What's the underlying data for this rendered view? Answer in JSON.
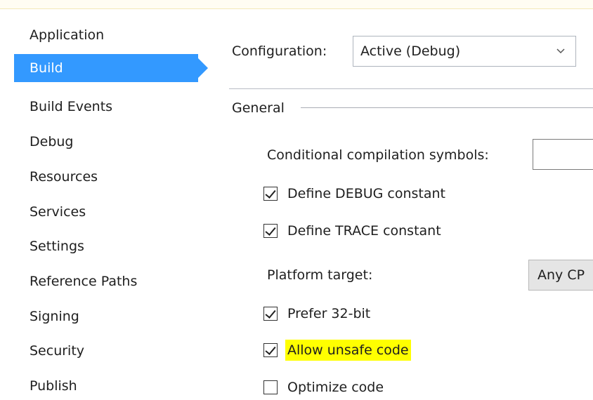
{
  "sidebar": {
    "items": [
      {
        "label": "Application"
      },
      {
        "label": "Build"
      },
      {
        "label": "Build Events"
      },
      {
        "label": "Debug"
      },
      {
        "label": "Resources"
      },
      {
        "label": "Services"
      },
      {
        "label": "Settings"
      },
      {
        "label": "Reference Paths"
      },
      {
        "label": "Signing"
      },
      {
        "label": "Security"
      },
      {
        "label": "Publish"
      }
    ],
    "selected": "Build"
  },
  "configuration": {
    "label": "Configuration:",
    "value": "Active (Debug)"
  },
  "general": {
    "heading": "General",
    "conditional_symbols_label": "Conditional compilation symbols:",
    "conditional_symbols_value": "",
    "define_debug": {
      "label": "Define DEBUG constant",
      "checked": true
    },
    "define_trace": {
      "label": "Define TRACE constant",
      "checked": true
    },
    "platform_target_label": "Platform target:",
    "platform_target_value": "Any CP",
    "prefer_32bit": {
      "label": "Prefer 32-bit",
      "checked": true
    },
    "allow_unsafe": {
      "label": "Allow unsafe code",
      "checked": true
    },
    "optimize": {
      "label": "Optimize code",
      "checked": false
    }
  },
  "colors": {
    "selected_nav": "#3399ff",
    "highlight": "#ffff00"
  }
}
